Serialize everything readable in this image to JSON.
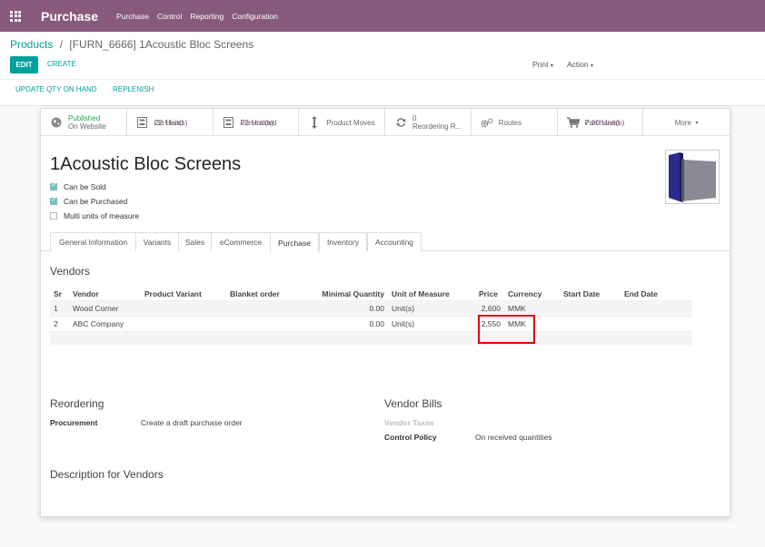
{
  "topbar": {
    "app_title": "Purchase",
    "menu": [
      "Purchase",
      "Control",
      "Reporting",
      "Configuration"
    ]
  },
  "breadcrumb": {
    "parent": "Products",
    "separator": "/",
    "current": "[FURN_6666] 1Acoustic Bloc Screens"
  },
  "buttons": {
    "edit": "EDIT",
    "create": "CREATE",
    "print": "Print",
    "action": "Action",
    "update_qty": "UPDATE QTY ON HAND",
    "replenish": "REPLENISH"
  },
  "smart_buttons": [
    {
      "line1": "Published",
      "line2": "On Website",
      "icon": "globe-icon"
    },
    {
      "line1": "22 Unit(s)",
      "line2": "On Hand",
      "icon": "inventory-icon"
    },
    {
      "line1": "22 Unit(s)",
      "line2": "Forecasted",
      "icon": "forecast-icon"
    },
    {
      "line1": "Product Moves",
      "line2": "",
      "icon": "up-down-arrow-icon"
    },
    {
      "line1": "0",
      "line2": "Reordering R...",
      "icon": "refresh-icon"
    },
    {
      "line1": "Routes",
      "line2": "",
      "icon": "gears-icon"
    },
    {
      "line1": "7.00 Unit(s)",
      "line2": "Purchased",
      "icon": "cart-icon"
    },
    {
      "line1": "More",
      "line2": "",
      "icon": "caret-down-icon"
    }
  ],
  "product": {
    "name": "1Acoustic Bloc Screens",
    "checkboxes": [
      {
        "label": "Can be Sold",
        "checked": true
      },
      {
        "label": "Can be Purchased",
        "checked": true
      },
      {
        "label": "Multi units of measure",
        "checked": false
      }
    ]
  },
  "tabs": [
    "General Information",
    "Variants",
    "Sales",
    "eCommerce",
    "Purchase",
    "Inventory",
    "Accounting"
  ],
  "active_tab": "Purchase",
  "vendors": {
    "title": "Vendors",
    "columns": [
      "Sr",
      "Vendor",
      "Product Variant",
      "Blanket order",
      "Minimal Quantity",
      "Unit of Measure",
      "Price",
      "Currency",
      "Start Date",
      "End Date"
    ],
    "rows": [
      {
        "sr": "1",
        "vendor": "Wood Corner",
        "variant": "",
        "blanket": "",
        "min_qty": "0.00",
        "uom": "Unit(s)",
        "price": "2,600",
        "currency": "MMK",
        "start": "",
        "end": ""
      },
      {
        "sr": "2",
        "vendor": "ABC Company",
        "variant": "",
        "blanket": "",
        "min_qty": "0.00",
        "uom": "Unit(s)",
        "price": "2,550",
        "currency": "MMK",
        "start": "",
        "end": ""
      }
    ]
  },
  "reordering": {
    "title": "Reordering",
    "procurement_label": "Procurement",
    "procurement_value": "Create a draft purchase order"
  },
  "vendor_bills": {
    "title": "Vendor Bills",
    "taxes_label": "Vendor Taxes",
    "policy_label": "Control Policy",
    "policy_value": "On received quantities"
  },
  "description_vendors": {
    "title": "Description for Vendors"
  },
  "colors": {
    "brand": "#875a7b",
    "accent": "#00a09d",
    "highlight": "#e00000"
  }
}
